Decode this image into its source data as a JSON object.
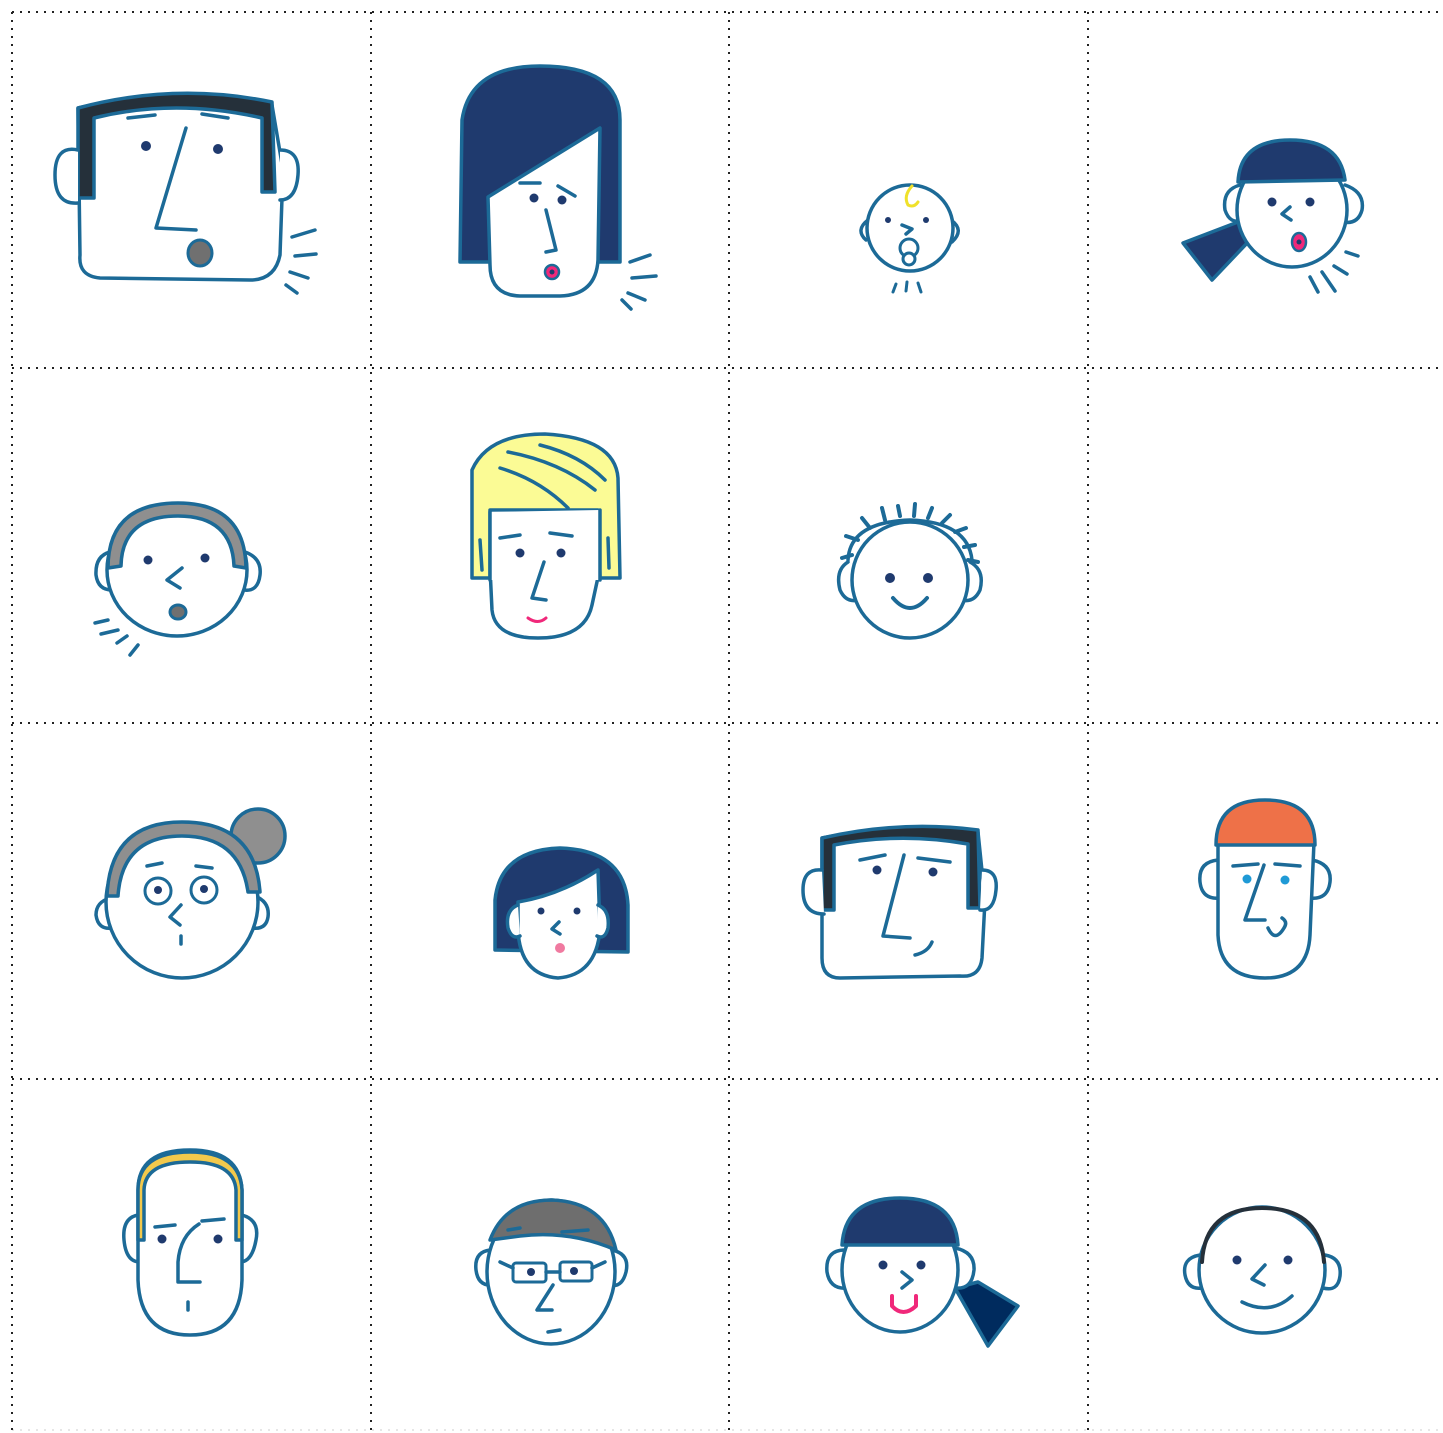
{
  "colors": {
    "outline": "#1c6a97",
    "navy": "#1f3a6e",
    "dark": "#25303a",
    "gray": "#8f8f8f",
    "yellow_hair": "#fbfb95",
    "orange": "#ee7148",
    "pink": "#f0287a",
    "gold": "#f2c94c",
    "grid": "#222222"
  },
  "faces": [
    {
      "name": "man-square-face-shouting",
      "icon": "man-square-face-icon"
    },
    {
      "name": "woman-long-hair-surprised",
      "icon": "woman-long-hair-icon"
    },
    {
      "name": "baby-pacifier",
      "icon": "baby-icon"
    },
    {
      "name": "girl-ponytail-surprised",
      "icon": "girl-ponytail-icon"
    },
    {
      "name": "boy-gray-hair-surprised",
      "icon": "boy-gray-hair-icon"
    },
    {
      "name": "woman-blonde-bob",
      "icon": "woman-blonde-icon"
    },
    {
      "name": "boy-spiky-hair-smiling",
      "icon": "boy-spiky-hair-icon"
    },
    {
      "name": "empty-cell",
      "icon": "empty-cell"
    },
    {
      "name": "grandma-bun-glasses",
      "icon": "grandma-icon"
    },
    {
      "name": "girl-bob-blushing",
      "icon": "girl-bob-icon"
    },
    {
      "name": "man-square-face-smirk",
      "icon": "man-smirk-icon"
    },
    {
      "name": "man-orange-hair-smiling",
      "icon": "man-orange-hair-icon"
    },
    {
      "name": "old-man-balding",
      "icon": "old-man-icon"
    },
    {
      "name": "man-glasses",
      "icon": "man-glasses-icon"
    },
    {
      "name": "girl-ponytail-happy",
      "icon": "girl-happy-ponytail-icon"
    },
    {
      "name": "boy-smiling",
      "icon": "boy-smiling-icon"
    }
  ]
}
